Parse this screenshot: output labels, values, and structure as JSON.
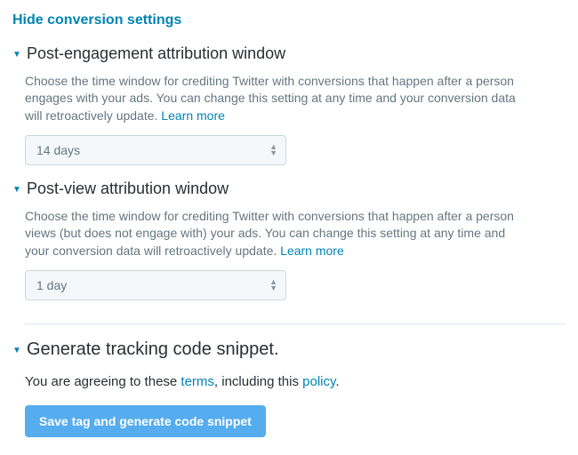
{
  "toggle_label": "Hide conversion settings",
  "sections": {
    "post_engagement": {
      "title": "Post-engagement attribution window",
      "desc": "Choose the time window for crediting Twitter with conversions that happen after a person engages with your ads. You can change this setting at any time and your conversion data will retroactively update.",
      "learn_more": "Learn more",
      "selected": "14 days"
    },
    "post_view": {
      "title": "Post-view attribution window",
      "desc": "Choose the time window for crediting Twitter with conversions that happen after a person views (but does not engage with) your ads. You can change this setting at any time and your conversion data will retroactively update.",
      "learn_more": "Learn more",
      "selected": "1 day"
    },
    "tracking": {
      "title": "Generate tracking code snippet.",
      "agree_pre": "You are agreeing to these ",
      "terms_label": "terms",
      "agree_mid": ", including this ",
      "policy_label": "policy",
      "agree_post": ".",
      "button": "Save tag and generate code snippet"
    }
  }
}
